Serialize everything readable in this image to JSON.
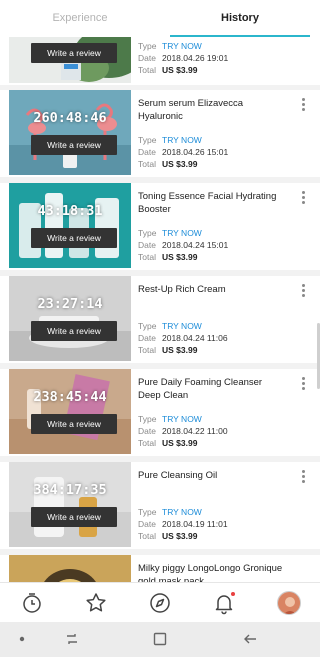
{
  "tabs": [
    {
      "label": "Experience",
      "active": false
    },
    {
      "label": "History",
      "active": true
    }
  ],
  "labels": {
    "type": "Type",
    "date": "Date",
    "total": "Total",
    "review_button": "Write a review"
  },
  "colors": {
    "accent": "#2bb6cc",
    "type_value": "#1c8cd8",
    "notification_dot": "#e84040"
  },
  "items": [
    {
      "title": "",
      "timer": "",
      "type": "TRY NOW",
      "date": "2018.04.26 19:01",
      "total": "US $3.99"
    },
    {
      "title": "Serum serum Elizavecca Hyaluronic",
      "timer": "260:48:46",
      "type": "TRY NOW",
      "date": "2018.04.26 15:01",
      "total": "US $3.99"
    },
    {
      "title": "Toning Essence Facial Hydrating Booster",
      "timer": "43:18:31",
      "type": "TRY NOW",
      "date": "2018.04.24 15:01",
      "total": "US $3.99"
    },
    {
      "title": "Rest-Up Rich Cream",
      "timer": "23:27:14",
      "type": "TRY NOW",
      "date": "2018.04.24 11:06",
      "total": "US $3.99"
    },
    {
      "title": "Pure Daily Foaming Cleanser Deep Clean",
      "timer": "238:45:44",
      "type": "TRY NOW",
      "date": "2018.04.22 11:00",
      "total": "US $3.99"
    },
    {
      "title": "Pure Cleansing Oil",
      "timer": "384:17:35",
      "type": "TRY NOW",
      "date": "2018.04.19 11:01",
      "total": "US $3.99"
    },
    {
      "title": "Milky piggy LongoLongo Gronique gold mask pack",
      "timer": "",
      "type": "",
      "date": "",
      "total": ""
    }
  ],
  "bottom_nav": [
    {
      "icon": "clock-icon"
    },
    {
      "icon": "star-icon"
    },
    {
      "icon": "compass-icon"
    },
    {
      "icon": "bell-icon",
      "badge": true
    },
    {
      "icon": "avatar"
    }
  ],
  "system_nav": [
    {
      "icon": "dot-icon"
    },
    {
      "icon": "recent-apps-icon"
    },
    {
      "icon": "home-icon"
    },
    {
      "icon": "back-icon"
    }
  ]
}
